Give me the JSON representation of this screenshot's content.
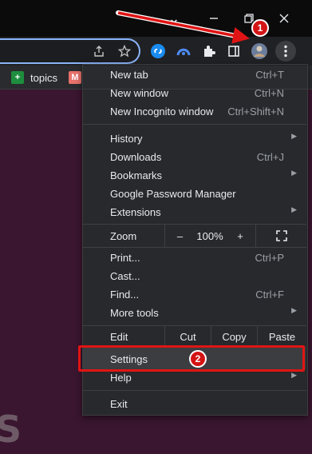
{
  "window": {
    "tab_chevron": "⌄",
    "icons": [
      "chevron-down-icon",
      "minimize-icon",
      "restore-icon",
      "close-icon"
    ]
  },
  "toolbar": {
    "icons": [
      "share-icon",
      "star-icon",
      "shazam-extension-icon",
      "vpn-extension-icon",
      "extensions-puzzle-icon",
      "reading-list-icon",
      "profile-avatar",
      "chrome-menu-icon"
    ]
  },
  "bookmarks": [
    {
      "label": "topics",
      "icon_color": "#1e8e3e",
      "icon_glyph": "+"
    },
    {
      "label": "",
      "icon_color": "#e8716b",
      "icon_glyph": "M"
    }
  ],
  "menu": {
    "new_tab": {
      "label": "New tab",
      "shortcut": "Ctrl+T"
    },
    "new_window": {
      "label": "New window",
      "shortcut": "Ctrl+N"
    },
    "new_incognito": {
      "label": "New Incognito window",
      "shortcut": "Ctrl+Shift+N"
    },
    "history": {
      "label": "History"
    },
    "downloads": {
      "label": "Downloads",
      "shortcut": "Ctrl+J"
    },
    "bookmarks": {
      "label": "Bookmarks"
    },
    "password_manager": {
      "label": "Google Password Manager"
    },
    "extensions": {
      "label": "Extensions"
    },
    "zoom": {
      "label": "Zoom",
      "minus": "–",
      "value": "100%",
      "plus": "+"
    },
    "print": {
      "label": "Print...",
      "shortcut": "Ctrl+P"
    },
    "cast": {
      "label": "Cast..."
    },
    "find": {
      "label": "Find...",
      "shortcut": "Ctrl+F"
    },
    "more_tools": {
      "label": "More tools"
    },
    "edit": {
      "label": "Edit",
      "cut": "Cut",
      "copy": "Copy",
      "paste": "Paste"
    },
    "settings": {
      "label": "Settings"
    },
    "help": {
      "label": "Help"
    },
    "exit": {
      "label": "Exit"
    },
    "submenu_arrow": "▶"
  },
  "annotations": {
    "step1": "1",
    "step2": "2",
    "color": "#e01414"
  },
  "page": {
    "partial_letter": "S"
  }
}
